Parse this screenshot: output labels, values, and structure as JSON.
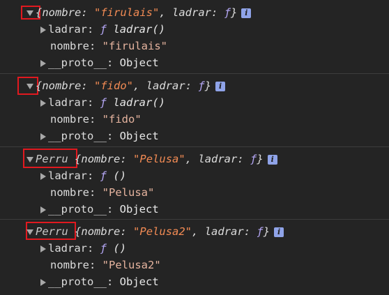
{
  "objects": [
    {
      "class_name": "",
      "summary": {
        "open_brace": "{",
        "k1": "nombre",
        "sep1": ": ",
        "v1": "\"firulais\"",
        "comma": ", ",
        "k2": "ladrar",
        "sep2": ": ",
        "v2": "ƒ",
        "close_brace": "}"
      },
      "info_label": "i",
      "props": [
        {
          "key": "ladrar",
          "sep": ": ",
          "func_symbol": "ƒ",
          "value": "ladrar()"
        },
        {
          "key": "nombre",
          "sep": ": ",
          "value": "\"firulais\""
        },
        {
          "key": "__proto__",
          "sep": ": ",
          "value": "Object"
        }
      ]
    },
    {
      "class_name": "",
      "summary": {
        "open_brace": "{",
        "k1": "nombre",
        "sep1": ": ",
        "v1": "\"fido\"",
        "comma": ", ",
        "k2": "ladrar",
        "sep2": ": ",
        "v2": "ƒ",
        "close_brace": "}"
      },
      "info_label": "i",
      "props": [
        {
          "key": "ladrar",
          "sep": ": ",
          "func_symbol": "ƒ",
          "value": "ladrar()"
        },
        {
          "key": "nombre",
          "sep": ": ",
          "value": "\"fido\""
        },
        {
          "key": "__proto__",
          "sep": ": ",
          "value": "Object"
        }
      ]
    },
    {
      "class_name": "Perru",
      "summary": {
        "open_brace": "{",
        "k1": "nombre",
        "sep1": ": ",
        "v1": "\"Pelusa\"",
        "comma": ", ",
        "k2": "ladrar",
        "sep2": ": ",
        "v2": "ƒ",
        "close_brace": "}"
      },
      "info_label": "i",
      "props": [
        {
          "key": "ladrar",
          "sep": ": ",
          "func_symbol": "ƒ",
          "value": "()"
        },
        {
          "key": "nombre",
          "sep": ": ",
          "value": "\"Pelusa\""
        },
        {
          "key": "__proto__",
          "sep": ": ",
          "value": "Object"
        }
      ]
    },
    {
      "class_name": "Perru",
      "summary": {
        "open_brace": "{",
        "k1": "nombre",
        "sep1": ": ",
        "v1": "\"Pelusa2\"",
        "comma": ", ",
        "k2": "ladrar",
        "sep2": ": ",
        "v2": "ƒ",
        "close_brace": "}"
      },
      "info_label": "i",
      "props": [
        {
          "key": "ladrar",
          "sep": ": ",
          "func_symbol": "ƒ",
          "value": "()"
        },
        {
          "key": "nombre",
          "sep": ": ",
          "value": "\"Pelusa2\""
        },
        {
          "key": "__proto__",
          "sep": ": ",
          "value": "Object"
        }
      ]
    }
  ],
  "colors": {
    "background": "#242424",
    "string": "#f28b54",
    "function": "#b5a7f5",
    "info_badge": "#8fa3e8",
    "highlight_box": "#e1191f",
    "separator": "#3d3d3d"
  }
}
